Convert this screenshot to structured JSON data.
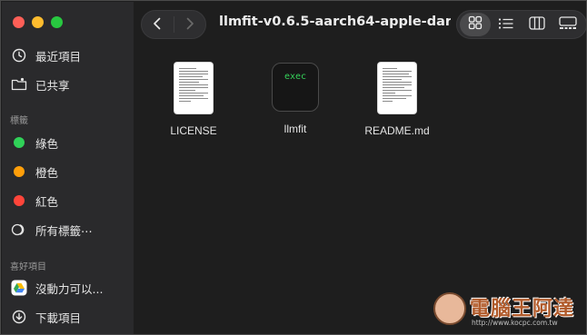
{
  "window": {
    "title": "llmfit-v0.6.5-aarch64-apple-dar..."
  },
  "sidebar": {
    "favorites_top": [
      {
        "label": "最近項目",
        "icon": "clock-icon"
      },
      {
        "label": "已共享",
        "icon": "shared-folder-icon"
      }
    ],
    "tags_header": "標籤",
    "tags": [
      {
        "label": "綠色",
        "color": "#30d158"
      },
      {
        "label": "橙色",
        "color": "#ff9f0a"
      },
      {
        "label": "紅色",
        "color": "#ff453a"
      }
    ],
    "all_tags_label": "所有標籤⋯",
    "favorites_header": "喜好項目",
    "favorites": [
      {
        "label": "沒動力可以...",
        "icon": "google-drive-icon"
      },
      {
        "label": "下載項目",
        "icon": "download-icon"
      }
    ]
  },
  "files": [
    {
      "name": "LICENSE",
      "kind": "document"
    },
    {
      "name": "llmfit",
      "kind": "exec",
      "badge": "exec"
    },
    {
      "name": "README.md",
      "kind": "document"
    }
  ],
  "watermark": {
    "text": "電腦王阿達",
    "url": "http://www.kocpc.com.tw"
  }
}
